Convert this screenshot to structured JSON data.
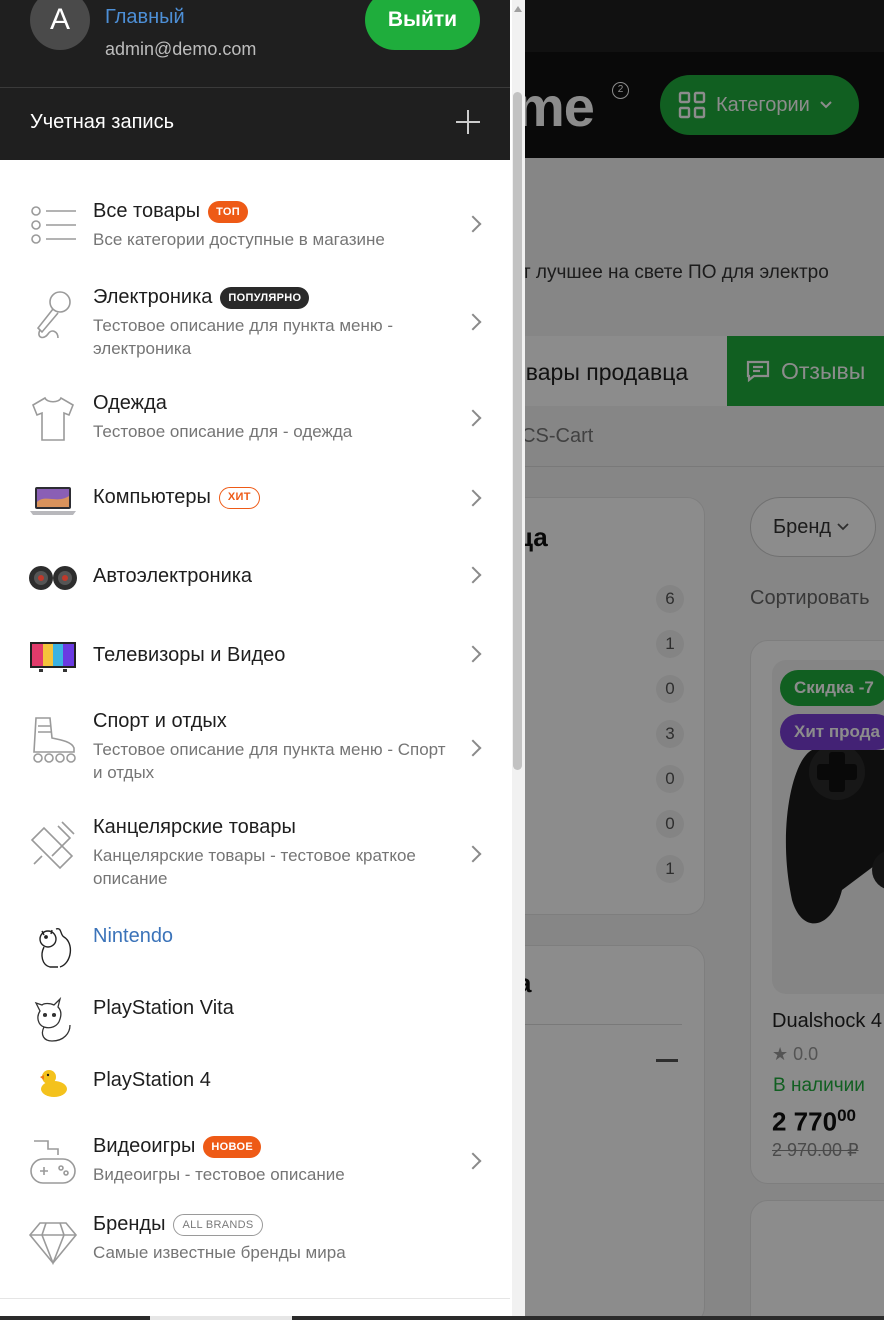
{
  "user": {
    "avatar_letter": "A",
    "role": "Главный",
    "email": "admin@demo.com",
    "logout_label": "Выйти"
  },
  "account": {
    "label": "Учетная запись"
  },
  "menu": [
    {
      "title": "Все товары",
      "tag": "ТОП",
      "desc": "Все категории доступные в магазине",
      "icon": "list-icon"
    },
    {
      "title": "Электроника",
      "tag": "ПОПУЛЯРНО",
      "desc": "Тестовое описание для пункта меню - электроника",
      "icon": "microphone-icon"
    },
    {
      "title": "Одежда",
      "desc": "Тестовое описание для - одежда",
      "icon": "tshirt-icon"
    },
    {
      "title": "Компьютеры",
      "tag": "ХИТ",
      "icon": "laptop-icon"
    },
    {
      "title": "Автоэлектроника",
      "icon": "speakers-icon"
    },
    {
      "title": "Телевизоры и Видео",
      "icon": "tv-icon"
    },
    {
      "title": "Спорт и отдых",
      "desc": "Тестовое описание для пункта меню - Спорт и отдых",
      "icon": "rollerskate-icon"
    },
    {
      "title": "Канцелярские товары",
      "desc": "Канцелярские товары - тестовое краткое описание",
      "icon": "pencil-icon"
    },
    {
      "title": "Nintendo",
      "icon": "squirrel-icon"
    },
    {
      "title": "PlayStation Vita",
      "icon": "cat-icon"
    },
    {
      "title": "PlayStation 4",
      "icon": "duck-icon"
    },
    {
      "title": "Видеоигры",
      "tag": "НОВОЕ",
      "desc": "Видеоигры - тестовое описание",
      "icon": "gamepad-icon"
    },
    {
      "title": "Бренды",
      "tag": "ALL BRANDS",
      "desc": "Самые известные бренды мира",
      "icon": "diamond-icon"
    }
  ],
  "background": {
    "logo": "me",
    "logo_sup": "2",
    "categories_label": "Категории",
    "tagline": "ет лучшее на свете ПО для электро",
    "tab_products": "овары продавца",
    "tab_reviews": "Отзывы",
    "breadcrumb": "/  CS-Cart",
    "card1_title": "ца",
    "counts": [
      "6",
      "1",
      "0",
      "3",
      "0",
      "0",
      "1"
    ],
    "card2_title": "а",
    "brand_filter": "Бренд",
    "sort_label": "Сортировать",
    "badge_discount": "Скидка -7",
    "badge_hit": "Хит прода",
    "product_name": "Dualshock 4",
    "rating": "0.0",
    "stock": "В наличии",
    "price_main": "2 770",
    "price_cents": "00",
    "old_price": "2 970.00 ₽"
  },
  "colors": {
    "accent_green": "#1fad3c",
    "tag_orange": "#ee5a16",
    "link_blue": "#3b73b9",
    "drawer_dark": "#1f1f1f"
  }
}
